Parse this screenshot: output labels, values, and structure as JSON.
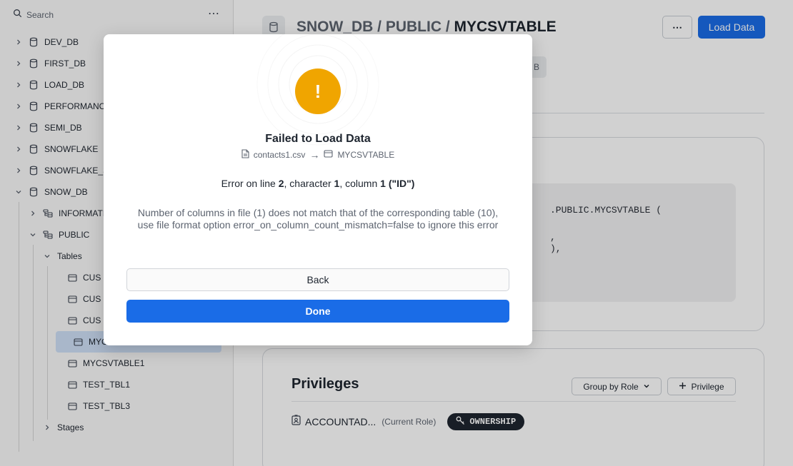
{
  "sidebar": {
    "search_label": "Search",
    "more_label": "⋯",
    "tree": [
      {
        "label": "DEV_DB",
        "level": 0,
        "expanded": false,
        "icon": "database-icon"
      },
      {
        "label": "FIRST_DB",
        "level": 0,
        "expanded": false,
        "icon": "database-icon"
      },
      {
        "label": "LOAD_DB",
        "level": 0,
        "expanded": false,
        "icon": "database-icon"
      },
      {
        "label": "PERFORMANCE",
        "level": 0,
        "expanded": false,
        "icon": "database-icon"
      },
      {
        "label": "SEMI_DB",
        "level": 0,
        "expanded": false,
        "icon": "database-icon"
      },
      {
        "label": "SNOWFLAKE",
        "level": 0,
        "expanded": false,
        "icon": "database-icon"
      },
      {
        "label": "SNOWFLAKE_S",
        "level": 0,
        "expanded": false,
        "icon": "database-icon"
      },
      {
        "label": "SNOW_DB",
        "level": 0,
        "expanded": true,
        "icon": "database-icon"
      },
      {
        "label": "INFORMATIO",
        "level": 1,
        "expanded": false,
        "icon": "schema-icon"
      },
      {
        "label": "PUBLIC",
        "level": 1,
        "expanded": true,
        "icon": "schema-icon"
      },
      {
        "label": "Tables",
        "level": 2,
        "expanded": true,
        "icon": ""
      },
      {
        "label": "CUS",
        "level": 3,
        "icon": "table-icon"
      },
      {
        "label": "CUS",
        "level": 3,
        "icon": "table-icon"
      },
      {
        "label": "CUS",
        "level": 3,
        "icon": "table-icon"
      },
      {
        "label": "MYC",
        "level": 3,
        "icon": "table-icon",
        "selected": true
      },
      {
        "label": "MYCSVTABLE1",
        "level": 3,
        "icon": "table-icon"
      },
      {
        "label": "TEST_TBL1",
        "level": 3,
        "icon": "table-icon"
      },
      {
        "label": "TEST_TBL3",
        "level": 3,
        "icon": "table-icon"
      },
      {
        "label": "Stages",
        "level": 2,
        "expanded": false,
        "icon": ""
      }
    ]
  },
  "header": {
    "crumb_prefix": "SNOW_DB / PUBLIC / ",
    "crumb_current": "MYCSVTABLE",
    "more_label": "⋯",
    "load_label": "Load Data",
    "tab_partial": "B"
  },
  "ddl": {
    "lines": [
      ".PUBLIC.MYCSVTABLE (",
      ",",
      "),"
    ]
  },
  "privileges": {
    "title": "Privileges",
    "group_label": "Group by Role",
    "add_label": "Privilege",
    "role_name": "ACCOUNTAD...",
    "role_tag": "(Current Role)",
    "ownership_label": "OWNERSHIP"
  },
  "modal": {
    "title": "Failed to Load Data",
    "file_name": "contacts1.csv",
    "arrow": "→",
    "table_name": "MYCSVTABLE",
    "error_prefix": "Error on line ",
    "error_line": "2",
    "error_char_label": ", character ",
    "error_char": "1",
    "error_col_label": ", column ",
    "error_col": "1 (\"ID\")",
    "detail": "Number of columns in file (1) does not match that of the corresponding table (10), use file format option error_on_column_count_mismatch=false to ignore this error",
    "back_label": "Back",
    "done_label": "Done"
  },
  "colors": {
    "accent": "#1a6ce7",
    "warning": "#f0a500",
    "selected_bg": "#cfe0f7"
  }
}
